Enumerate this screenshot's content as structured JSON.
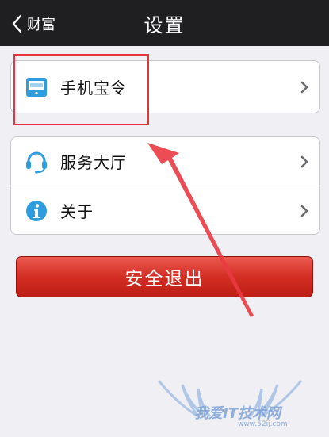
{
  "navbar": {
    "back_label": "财富",
    "title": "设置"
  },
  "groups": [
    {
      "items": [
        {
          "label": "手机宝令",
          "icon": "token-device-icon"
        }
      ]
    },
    {
      "items": [
        {
          "label": "服务大厅",
          "icon": "headset-icon"
        },
        {
          "label": "关于",
          "icon": "info-icon"
        }
      ]
    }
  ],
  "logout": {
    "label": "安全退出"
  },
  "colors": {
    "navbar_bg": "#1f1f22",
    "page_bg": "#efeff4",
    "accent_blue": "#2e9de0",
    "logout_red": "#d32e24",
    "annotation_red": "#e8323c"
  },
  "watermark": {
    "text": "我爱IT技术网",
    "url": "www.52ij.com"
  }
}
